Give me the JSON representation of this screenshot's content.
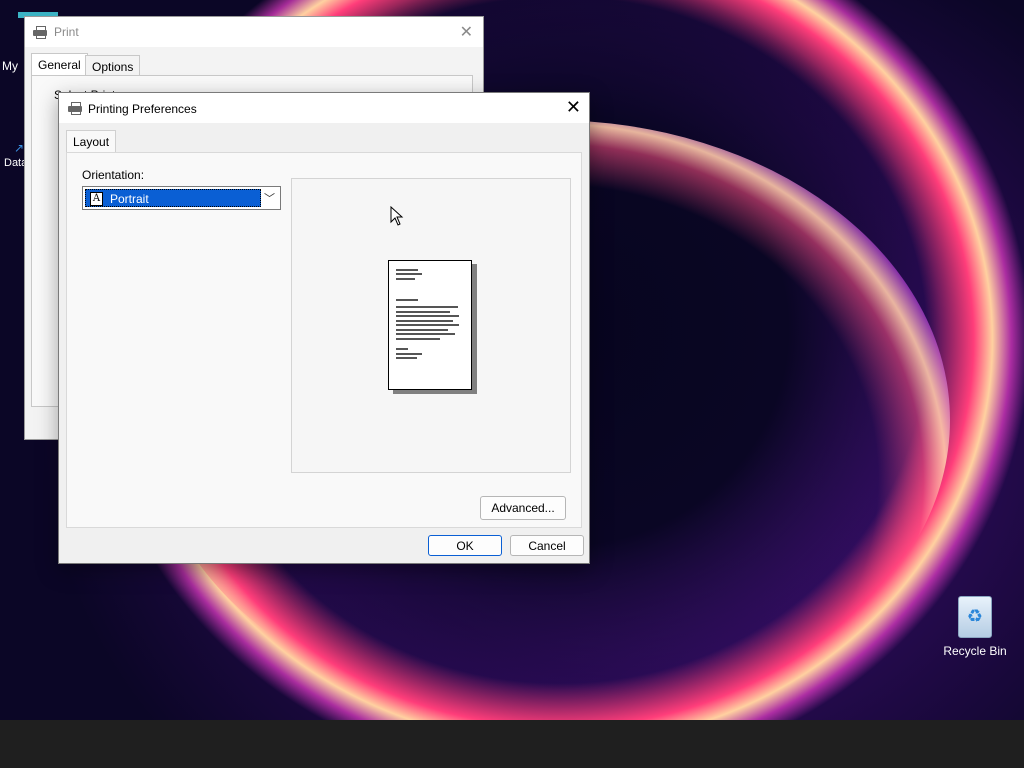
{
  "desktop": {
    "recycle_bin_label": "Recycle Bin",
    "partial_label_1": "My",
    "partial_label_2": "Data"
  },
  "print_window": {
    "title": "Print",
    "tabs": [
      {
        "label": "General"
      },
      {
        "label": "Options"
      }
    ],
    "partial_group_label": "Select Printer"
  },
  "prefs": {
    "title": "Printing Preferences",
    "tab_label": "Layout",
    "orientation_label": "Orientation:",
    "orientation_value": "Portrait",
    "advanced_label": "Advanced...",
    "ok_label": "OK",
    "cancel_label": "Cancel"
  },
  "colors": {
    "selection": "#0a5fd4",
    "dialog_bg": "#f0f0f0"
  }
}
